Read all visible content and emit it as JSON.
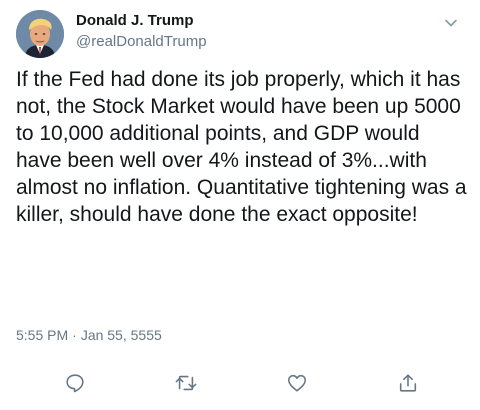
{
  "author": {
    "display_name": "Donald J. Trump",
    "handle": "@realDonaldTrump"
  },
  "tweet": {
    "text": "If the Fed had done its job properly, which it has not, the Stock Market would have been up 5000 to 10,000 additional points, and GDP would have been well over 4% instead of 3%...with almost no inflation. Quantitative tightening was a killer, should have done the exact opposite!",
    "time": "5:55 PM",
    "separator": "·",
    "date": "Jan 55, 5555"
  },
  "icons": {
    "menu": "chevron-down-icon",
    "reply": "reply-icon",
    "retweet": "retweet-icon",
    "like": "heart-icon",
    "share": "share-icon"
  },
  "colors": {
    "text": "#14171a",
    "secondary": "#657786",
    "background": "#ffffff"
  }
}
